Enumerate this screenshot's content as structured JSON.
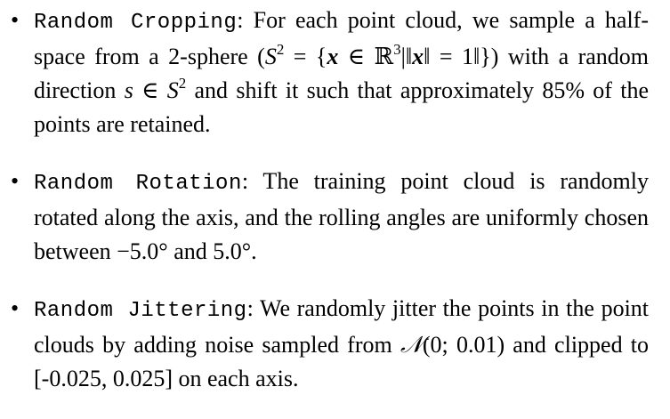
{
  "items": [
    {
      "term": "Random Cropping",
      "sep": ":",
      "text_a": " For each point cloud, we sample a half-space from a 2-sphere (",
      "math_sphere": "S",
      "math_sphere_exp": "2",
      "math_eq": " = {",
      "math_x1": "x",
      "math_in": " ∈ ℝ",
      "math_r_exp": "3",
      "math_norm1": "|‖",
      "math_x2": "x",
      "math_norm2": "‖ = 1‖})",
      "text_b": " with a random direction ",
      "math_s": "s",
      "math_in2": " ∈ ",
      "math_S2": "S",
      "math_S2_exp": "2",
      "text_c": " and shift it such that approximately ",
      "math_pct": "85%",
      "text_d": " of the points are retained."
    },
    {
      "term": "Random Rotation",
      "sep": ":",
      "text_a": " The training point cloud is randomly rotated along the axis, and the rolling angles are uniformly chosen between ",
      "math_neg": "−5.0°",
      "text_b": " and ",
      "math_pos": "5.0°",
      "text_c": "."
    },
    {
      "term": "Random Jittering",
      "sep": ":",
      "text_a": " We randomly jitter the points in the point clouds by adding noise sampled from ",
      "math_N": "𝒩",
      "math_args": "(0; 0.01)",
      "text_b": " and clipped to [-0.025, 0.025] on each axis."
    }
  ],
  "bullet_glyph": "•"
}
